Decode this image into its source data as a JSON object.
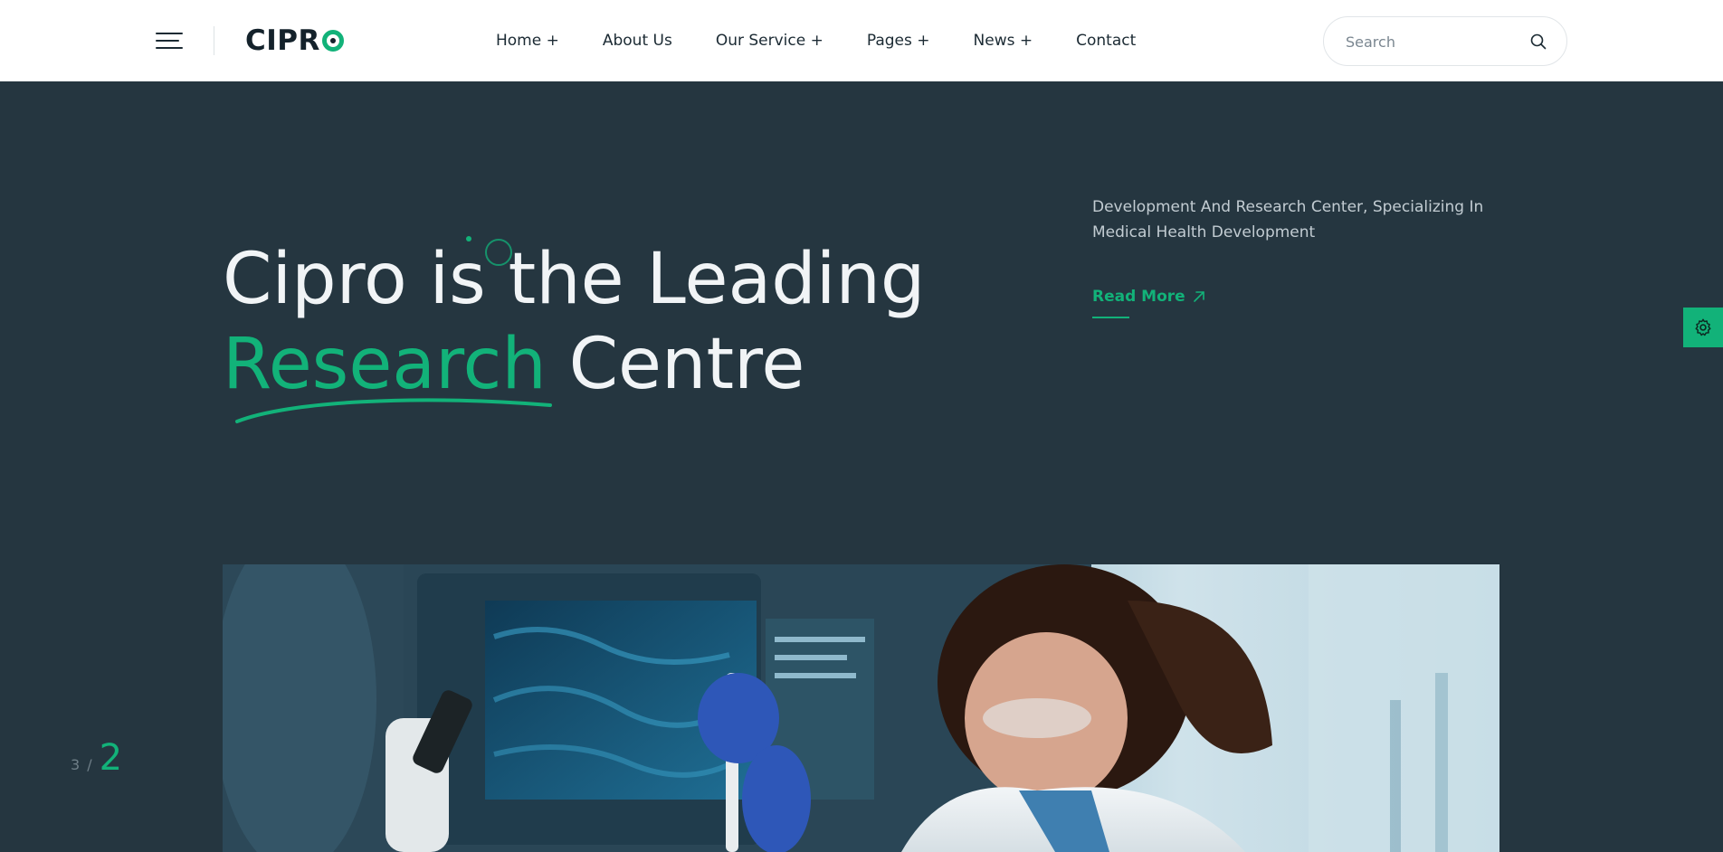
{
  "header": {
    "logo_text": "CIPR",
    "nav": [
      "Home +",
      "About Us",
      "Our Service +",
      "Pages +",
      "News +",
      "Contact"
    ],
    "search_placeholder": "Search"
  },
  "hero": {
    "title_line1": "Cipro is the Leading",
    "title_accent": "Research",
    "title_rest": " Centre",
    "description": "Development And Research Center, Specializing In Medical Health Development",
    "read_more": "Read More"
  },
  "slider": {
    "total": "3",
    "separator": "/",
    "current": "2"
  },
  "icons": {
    "menu": "hamburger-menu-icon",
    "search": "search-icon",
    "arrow": "arrow-up-right-icon",
    "settings": "gear-icon"
  },
  "colors": {
    "accent": "#12b279",
    "hero_bg": "#253640",
    "header_bg": "#ffffff",
    "text_dark": "#14222b"
  }
}
